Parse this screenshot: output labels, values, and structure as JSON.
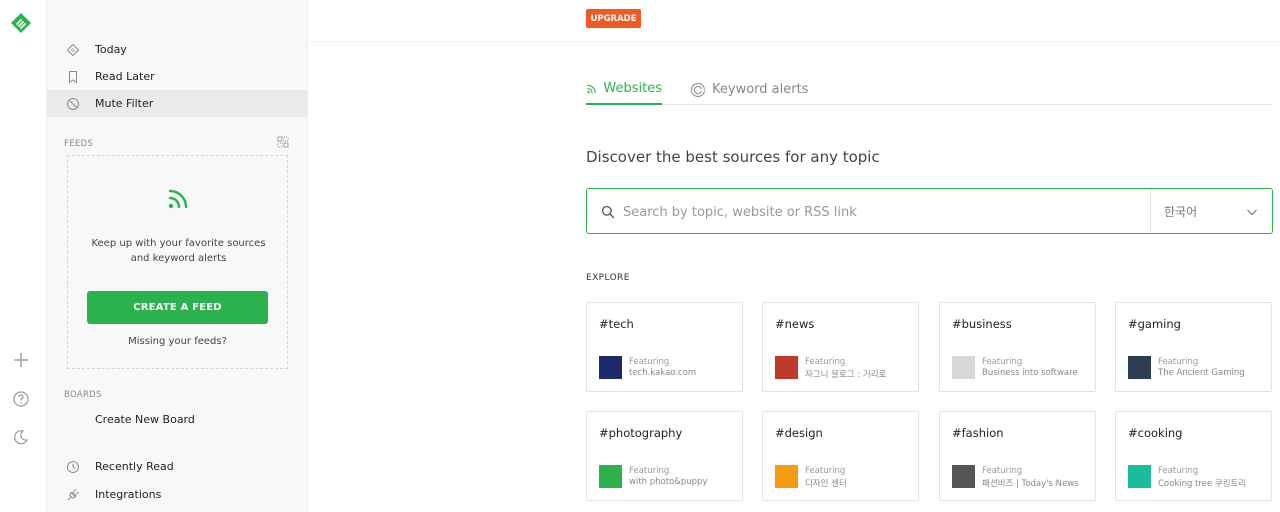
{
  "app": {
    "accent_color": "#2bb24c",
    "upgrade_color": "#f15a24"
  },
  "rail": {
    "logo_icon": "feedly-logo-icon",
    "add_icon": "plus-icon",
    "help_icon": "help-circle-icon",
    "theme_icon": "moon-icon"
  },
  "sidebar": {
    "nav": [
      {
        "label": "Today",
        "icon": "diamond-icon"
      },
      {
        "label": "Read Later",
        "icon": "bookmark-icon"
      },
      {
        "label": "Mute Filter",
        "icon": "mute-icon"
      }
    ],
    "feeds_label": "FEEDS",
    "feed_empty": {
      "description": "Keep up with your favorite sources and keyword alerts",
      "create_label": "CREATE A FEED",
      "missing_label": "Missing your feeds?"
    },
    "boards_label": "BOARDS",
    "create_board": "Create New Board",
    "bottom_nav": [
      {
        "label": "Recently Read",
        "icon": "clock-icon"
      },
      {
        "label": "Integrations",
        "icon": "plug-icon"
      }
    ]
  },
  "header": {
    "upgrade_label": "UPGRADE"
  },
  "tabs": [
    {
      "label": "Websites",
      "icon": "rss-icon",
      "active": true
    },
    {
      "label": "Keyword alerts",
      "icon": "keyword-alert-icon",
      "active": false
    }
  ],
  "discover_title": "Discover the best sources for any topic",
  "search": {
    "placeholder": "Search by topic, website or RSS link",
    "value": "",
    "language": "한국어"
  },
  "explore": {
    "label": "EXPLORE",
    "featuring_label": "Featuring",
    "cards": [
      {
        "topic": "#tech",
        "source": "tech.kakao.com",
        "thumb_color": "#1e2a6b"
      },
      {
        "topic": "#news",
        "source": "자그니 블로그 : 거리로",
        "thumb_color": "#c0392b"
      },
      {
        "topic": "#business",
        "source": "Business into software",
        "thumb_color": "#d8d8d8"
      },
      {
        "topic": "#gaming",
        "source": "The Ancient Gaming",
        "thumb_color": "#2c3e50"
      },
      {
        "topic": "#photography",
        "source": "with photo&puppy",
        "thumb_color": "#2bb24c"
      },
      {
        "topic": "#design",
        "source": "디자인 센터",
        "thumb_color": "#f39c12"
      },
      {
        "topic": "#fashion",
        "source": "패션비즈 | Today's News",
        "thumb_color": "#555555"
      },
      {
        "topic": "#cooking",
        "source": "Cooking tree 쿠킹트리",
        "thumb_color": "#1abc9c"
      }
    ]
  }
}
